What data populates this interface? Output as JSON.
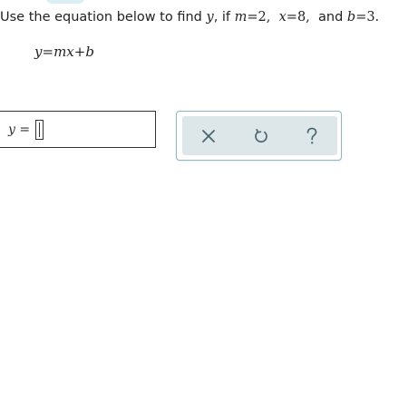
{
  "problem": {
    "prefix": "Use the equation below to find ",
    "target_var": "y",
    "mid": ", if ",
    "m_var": "m",
    "m_eq": "=2,",
    "x_var": "x",
    "x_eq": "=8,",
    "and_text": "and ",
    "b_var": "b",
    "b_eq": "=3."
  },
  "equation": {
    "lhs": "y",
    "eq": "=",
    "m": "m",
    "x": "x",
    "plus": "+",
    "b": "b"
  },
  "answer": {
    "label_var": "y",
    "label_eq": " = ",
    "value": ""
  },
  "tools": {
    "clear_icon": "close-icon",
    "undo_icon": "undo-icon",
    "help_icon": "help-icon",
    "icon_color": "#4a6570"
  }
}
